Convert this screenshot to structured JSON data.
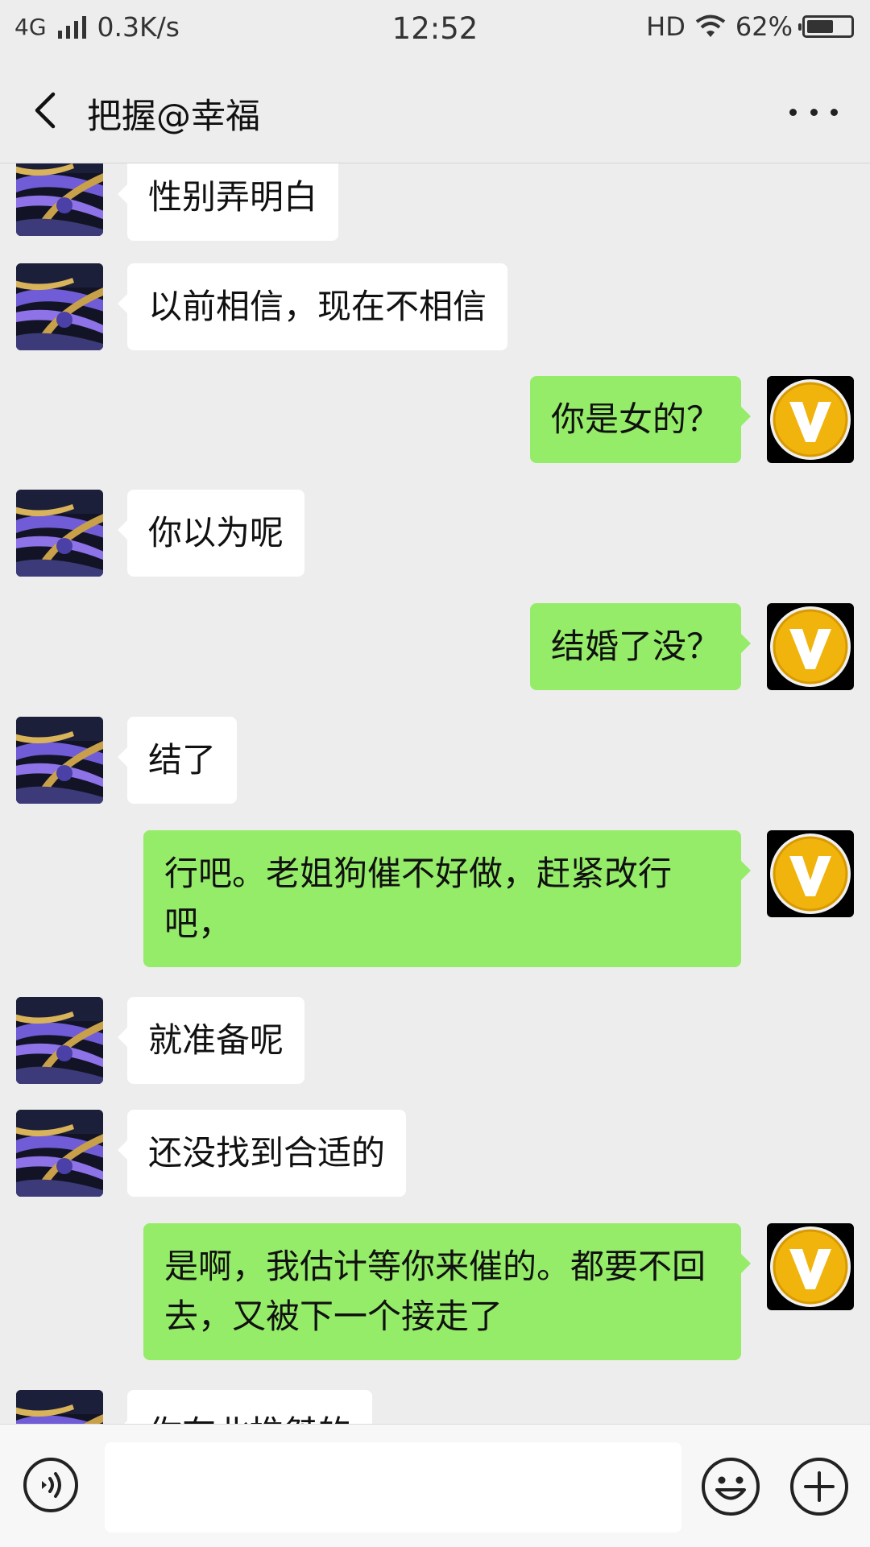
{
  "status_bar": {
    "network": "4G",
    "speed": "0.3K/s",
    "time": "12:52",
    "hd": "HD",
    "battery": "62%",
    "battery_level": 0.62
  },
  "header": {
    "title": "把握@幸福"
  },
  "colors": {
    "background": "#ededed",
    "sent_bubble": "#95ec69",
    "received_bubble": "#ffffff"
  },
  "messages": [
    {
      "side": "left",
      "text": "性别弄明白"
    },
    {
      "side": "left",
      "text": "以前相信，现在不相信"
    },
    {
      "side": "right",
      "text": "你是女的？"
    },
    {
      "side": "left",
      "text": "你以为呢"
    },
    {
      "side": "right",
      "text": "结婚了没？"
    },
    {
      "side": "left",
      "text": "结了"
    },
    {
      "side": "right",
      "text": "行吧。老姐狗催不好做，赶紧改行吧，"
    },
    {
      "side": "left",
      "text": "就准备呢"
    },
    {
      "side": "left",
      "text": "还没找到合适的"
    },
    {
      "side": "right",
      "text": "是啊，我估计等你来催的。都要不回去，又被下一个接走了"
    },
    {
      "side": "left",
      "text": "你在北推桀的"
    }
  ],
  "icons": {
    "back": "back-arrow-icon",
    "more": "more-icon",
    "voice": "voice-icon",
    "emoji": "emoji-icon",
    "plus": "plus-icon",
    "self_avatar": "v-logo-avatar",
    "contact_avatar": "night-overpass-avatar"
  }
}
